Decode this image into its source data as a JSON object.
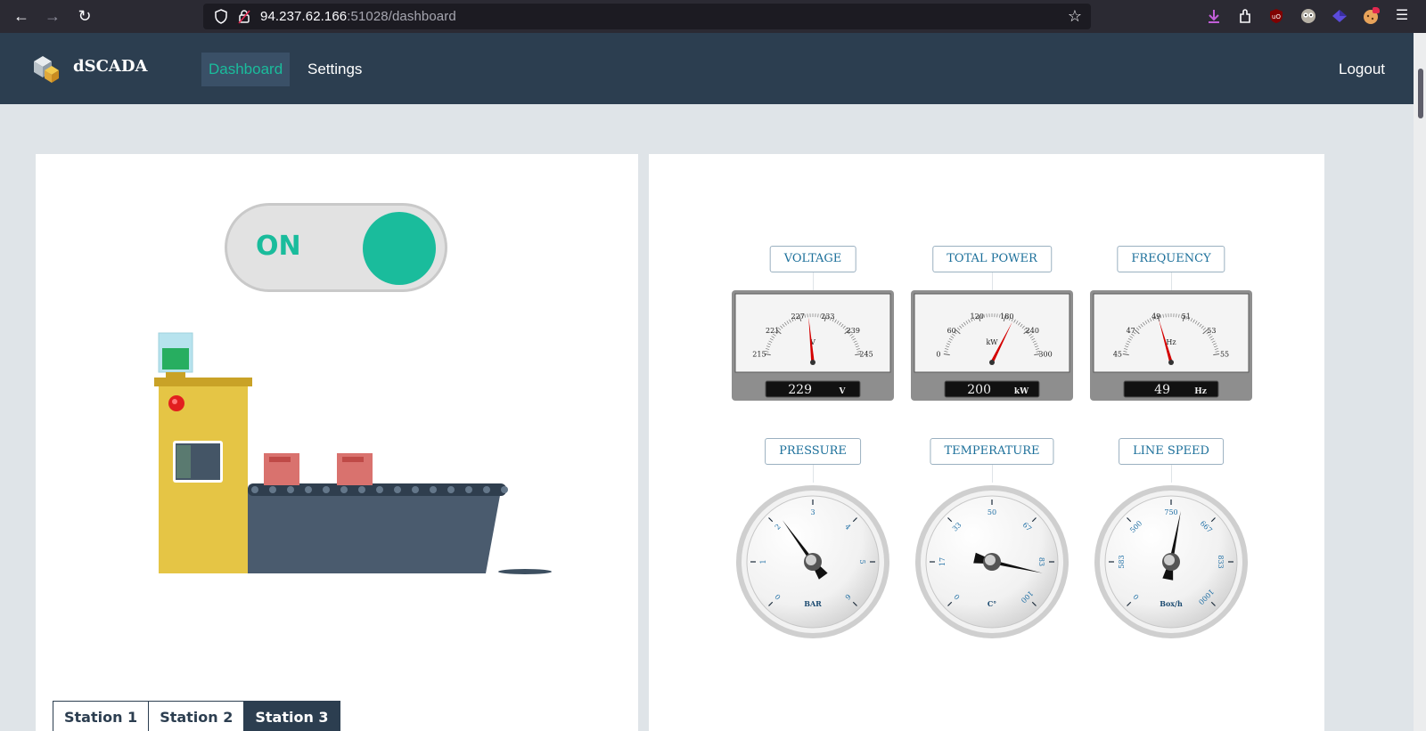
{
  "browser": {
    "url_host": "94.237.62.166",
    "url_rest": ":51028/dashboard"
  },
  "navbar": {
    "brand": "dSCADA",
    "links": [
      {
        "label": "Dashboard",
        "active": true
      },
      {
        "label": "Settings",
        "active": false
      }
    ],
    "logout_label": "Logout"
  },
  "control": {
    "switch_label": "ON",
    "switch_state": "on",
    "accent_color": "#1abc9c"
  },
  "stations": {
    "tabs": [
      "Station 1",
      "Station 2",
      "Station 3"
    ],
    "active": "Station 3"
  },
  "gauges": {
    "voltage": {
      "title": "VOLTAGE",
      "unit": "V",
      "readout": "229",
      "readout_unit": "V",
      "ticks": [
        "215",
        "221",
        "227",
        "233",
        "239",
        "245"
      ],
      "min": 215,
      "max": 245,
      "value": 229
    },
    "power": {
      "title": "TOTAL POWER",
      "unit": "kW",
      "readout": "200",
      "readout_unit": "kW",
      "ticks": [
        "0",
        "60",
        "120",
        "180",
        "240",
        "300"
      ],
      "min": 0,
      "max": 300,
      "value": 200
    },
    "frequency": {
      "title": "FREQUENCY",
      "unit": "Hz",
      "readout": "49",
      "readout_unit": "Hz",
      "ticks": [
        "45",
        "47",
        "49",
        "51",
        "53",
        "55"
      ],
      "min": 45,
      "max": 55,
      "value": 49
    },
    "pressure": {
      "title": "PRESSURE",
      "unit": "BAR",
      "ticks": [
        "0",
        "1",
        "2",
        "3",
        "4",
        "5",
        "6"
      ],
      "min": 0,
      "max": 6,
      "value": 2.2
    },
    "temperature": {
      "title": "TEMPERATURE",
      "unit": "C°",
      "ticks": [
        "0",
        "17",
        "33",
        "50",
        "67",
        "83",
        "100"
      ],
      "min": 0,
      "max": 100,
      "value": 88
    },
    "linespeed": {
      "title": "LINE SPEED",
      "unit": "Box/h",
      "ticks": [
        "0",
        "583",
        "500",
        "750",
        "667",
        "833",
        "1000"
      ],
      "min": 0,
      "max": 1000,
      "value": 540
    }
  }
}
